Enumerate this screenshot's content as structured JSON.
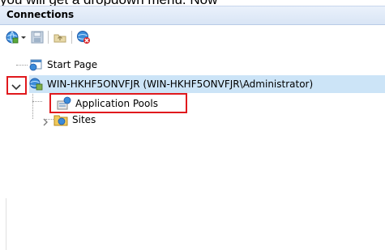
{
  "caption": "you will get a dropdown menu. Now",
  "panel": {
    "title": "Connections"
  },
  "toolbar": {
    "icons": [
      "connect-globe-icon",
      "dropdown-arrow-icon",
      "save-icon",
      "up-level-icon",
      "disconnect-icon"
    ]
  },
  "tree": {
    "start_page": "Start Page",
    "server": "WIN-HKHF5ONVFJR (WIN-HKHF5ONVFJR\\Administrator)",
    "app_pools": "Application Pools",
    "sites": "Sites"
  },
  "colors": {
    "highlight": "#e0191d",
    "selection": "#cce4f7",
    "header": "#dbe6f6"
  }
}
